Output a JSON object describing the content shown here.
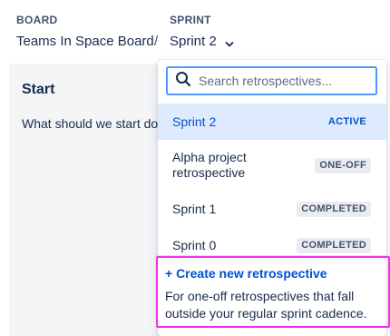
{
  "header": {
    "board_label": "BOARD",
    "board_value": "Teams In Space Board",
    "separator": "/",
    "sprint_label": "SPRINT",
    "sprint_value": "Sprint 2"
  },
  "start_column": {
    "title": "Start",
    "description": "What should we start do"
  },
  "dropdown": {
    "search_placeholder": "Search retrospectives...",
    "items": [
      {
        "label": "Sprint 2",
        "status": "ACTIVE",
        "selected": true
      },
      {
        "label": "Alpha project retrospective",
        "status": "ONE-OFF",
        "selected": false
      },
      {
        "label": "Sprint 1",
        "status": "COMPLETED",
        "selected": false
      },
      {
        "label": "Sprint 0",
        "status": "COMPLETED",
        "selected": false
      }
    ],
    "create_label": "+ Create new retrospective",
    "create_description": "For one-off retrospectives that fall outside your regular sprint cadence."
  },
  "icons": {
    "search": "search-icon",
    "chevron": "chevron-down-icon"
  },
  "colors": {
    "link_blue": "#0052CC",
    "focus_blue": "#4C9AFF",
    "selected_bg": "#DEEBFF",
    "highlight_magenta": "#F032E6"
  }
}
